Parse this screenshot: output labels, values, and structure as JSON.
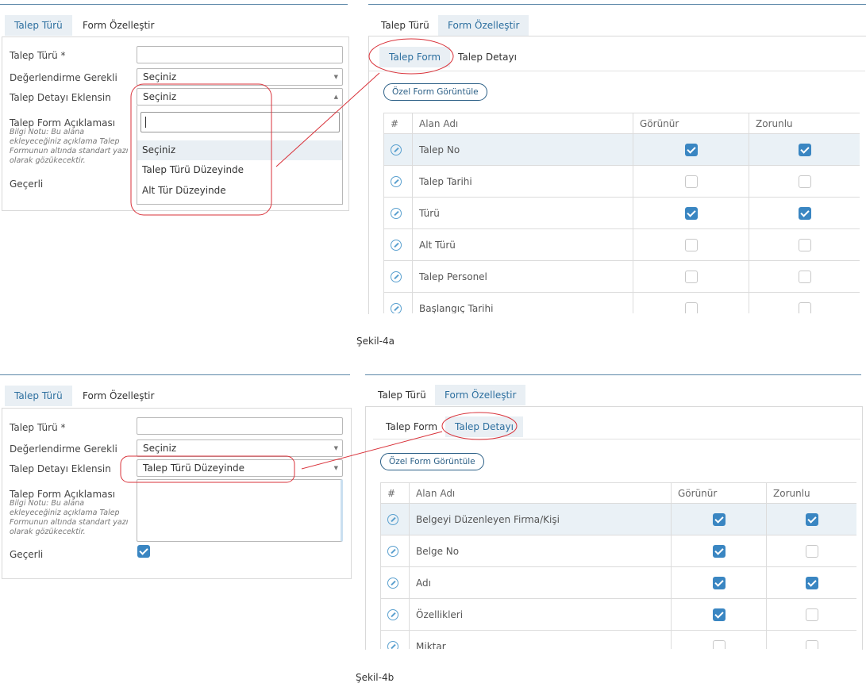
{
  "fig_a": {
    "left": {
      "tabs": [
        "Talep Türü",
        "Form Özelleştir"
      ],
      "labels": {
        "talep_turu": "Talep Türü *",
        "degerlendirme": "Değerlendirme Gerekli",
        "detay_eklensin": "Talep Detayı Eklensin",
        "aciklama": "Talep Form Açıklaması",
        "note": "Bilgi Notu: Bu alana ekleyeceğiniz açıklama Talep Formunun altında standart yazı olarak gözükecektir.",
        "gecerli": "Geçerli"
      },
      "degerlendirme_value": "Seçiniz",
      "detay_value": "Seçiniz",
      "dropdown_options": [
        "Seçiniz",
        "Talep Türü Düzeyinde",
        "Alt Tür Düzeyinde"
      ]
    },
    "right": {
      "tabs": [
        "Talep Türü",
        "Form Özelleştir"
      ],
      "subtabs": [
        "Talep Form",
        "Talep Detayı"
      ],
      "view_button": "Özel Form Görüntüle",
      "headers": [
        "#",
        "Alan Adı",
        "Görünür",
        "Zorunlu"
      ],
      "rows": [
        {
          "name": "Talep No",
          "gorunur": true,
          "zorunlu": true
        },
        {
          "name": "Talep Tarihi",
          "gorunur": false,
          "zorunlu": false
        },
        {
          "name": "Türü",
          "gorunur": true,
          "zorunlu": true
        },
        {
          "name": "Alt Türü",
          "gorunur": false,
          "zorunlu": false
        },
        {
          "name": "Talep Personel",
          "gorunur": false,
          "zorunlu": false
        },
        {
          "name": "Başlangıç Tarihi",
          "gorunur": false,
          "zorunlu": false
        }
      ]
    },
    "caption": "Şekil-4a"
  },
  "fig_b": {
    "left": {
      "tabs": [
        "Talep Türü",
        "Form Özelleştir"
      ],
      "labels": {
        "talep_turu": "Talep Türü *",
        "degerlendirme": "Değerlendirme Gerekli",
        "detay_eklensin": "Talep Detayı Eklensin",
        "aciklama": "Talep Form Açıklaması",
        "note": "Bilgi Notu: Bu alana ekleyeceğiniz açıklama Talep Formunun altında standart yazı olarak gözükecektir.",
        "gecerli": "Geçerli"
      },
      "degerlendirme_value": "Seçiniz",
      "detay_value": "Talep Türü Düzeyinde",
      "gecerli_checked": true
    },
    "right": {
      "tabs": [
        "Talep Türü",
        "Form Özelleştir"
      ],
      "subtabs": [
        "Talep Form",
        "Talep Detayı"
      ],
      "view_button": "Özel Form Görüntüle",
      "headers": [
        "#",
        "Alan Adı",
        "Görünür",
        "Zorunlu"
      ],
      "rows": [
        {
          "name": "Belgeyi Düzenleyen Firma/Kişi",
          "gorunur": true,
          "zorunlu": true
        },
        {
          "name": "Belge No",
          "gorunur": true,
          "zorunlu": false
        },
        {
          "name": "Adı",
          "gorunur": true,
          "zorunlu": true
        },
        {
          "name": "Özellikleri",
          "gorunur": true,
          "zorunlu": false
        },
        {
          "name": "Miktar",
          "gorunur": false,
          "zorunlu": false
        }
      ]
    },
    "caption": "Şekil-4b"
  },
  "colors": {
    "accent": "#2d6f9f",
    "check": "#3a86c2",
    "highlight_circle": "#d9323a"
  }
}
